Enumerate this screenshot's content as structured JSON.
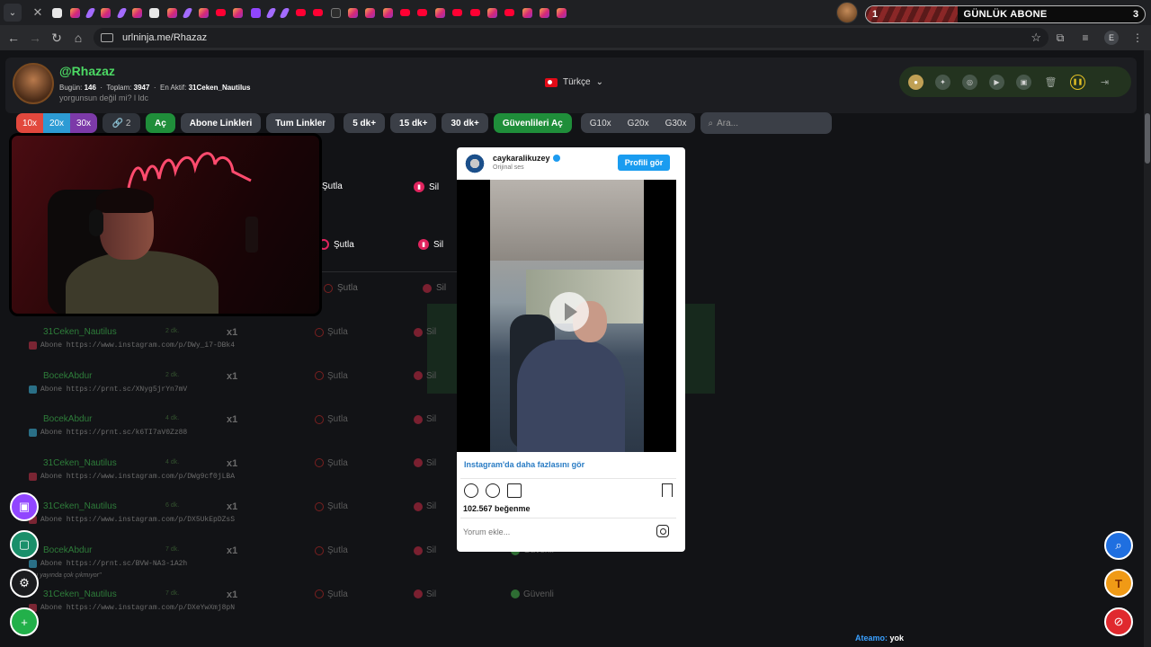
{
  "browser": {
    "url": "urlninja.me/Rhazaz",
    "tab_favicons": [
      "x",
      "ig",
      "feather",
      "ig",
      "feather",
      "ig",
      "x",
      "ig",
      "feather",
      "ig",
      "yt",
      "ig",
      "tw",
      "feather",
      "feather",
      "yt",
      "yt",
      "g",
      "ig",
      "ig",
      "ig",
      "yt",
      "yt",
      "ig",
      "yt",
      "yt",
      "ig",
      "yt",
      "ig",
      "ig",
      "ig"
    ]
  },
  "overlay": {
    "title": "GÜNLÜK ABONE",
    "current": "1",
    "goal": "3",
    "progress": 0.33
  },
  "profile": {
    "username": "@Rhazaz",
    "today_label": "Bugün:",
    "today_value": "146",
    "total_label": "Toplam:",
    "total_value": "3947",
    "active_label": "En Aktif:",
    "active_value": "31Ceken_Nautilus",
    "subtitle": "yorgunsun değil mi? l ldc"
  },
  "language": "Türkçe",
  "toolbar": {
    "mult1": "10x",
    "mult2": "20x",
    "mult3": "30x",
    "link_count": "2",
    "open": "Aç",
    "sub_links": "Abone Linkleri",
    "all_links": "Tum Linkler",
    "m5": "5 dk+",
    "m15": "15 dk+",
    "m30": "30 dk+",
    "open_safe": "Güvenlileri Aç",
    "g10": "G10x",
    "g20": "G20x",
    "g30": "G30x",
    "search_placeholder": "Ara..."
  },
  "labels": {
    "sutla": "Şutla",
    "sil": "Sil",
    "guvenli": "Güvenli"
  },
  "rows": [
    {
      "name": "31Ceken_Nautilus",
      "time": "2 dk.",
      "count": "x1",
      "link": "Abone https://www.instagram.com/p/DWy_i7-DBk4",
      "type": "ig"
    },
    {
      "name": "BocekAbdur",
      "time": "2 dk.",
      "count": "x1",
      "link": "Abone https://prnt.sc/XNyg5jrYn7mV",
      "type": "pr"
    },
    {
      "name": "BocekAbdur",
      "time": "4 dk.",
      "count": "x1",
      "link": "Abone https://prnt.sc/k6TI7aV0Zz88",
      "type": "pr"
    },
    {
      "name": "31Ceken_Nautilus",
      "time": "4 dk.",
      "count": "x1",
      "link": "Abone https://www.instagram.com/p/DWg9cf0jLBA",
      "type": "ig"
    },
    {
      "name": "31Ceken_Nautilus",
      "time": "6 dk.",
      "count": "x1",
      "link": "Abone https://www.instagram.com/p/DX5UkEpDZsS",
      "type": "ig"
    },
    {
      "name": "BocekAbdur",
      "time": "7 dk.",
      "count": "x1",
      "link": "Abone https://prnt.sc/BVW-NA3-1A2h",
      "type": "pr",
      "quote": "\"bu yayında çok çıkmıyor\"",
      "guvenli": true
    },
    {
      "name": "31Ceken_Nautilus",
      "time": "7 dk.",
      "count": "x1",
      "link": "Abone https://www.instagram.com/p/DXeYwXmj8pN",
      "type": "ig",
      "guvenli": true
    }
  ],
  "instagram": {
    "user": "caykaralikuzey",
    "sub": "Orijinal ses",
    "profile_btn": "Profili gör",
    "more": "Instagram'da daha fazlasını gör",
    "likes": "102.567 beğenme",
    "comment_placeholder": "Yorum ekle..."
  },
  "footer": {
    "ateamo_label": "Ateamo:",
    "ateamo_value": "yok"
  },
  "colors": {
    "brand_green": "#4cd964",
    "button_green": "#1f8e3a",
    "twitch": "#9146ff",
    "instagram_blue": "#1a9cf0"
  }
}
